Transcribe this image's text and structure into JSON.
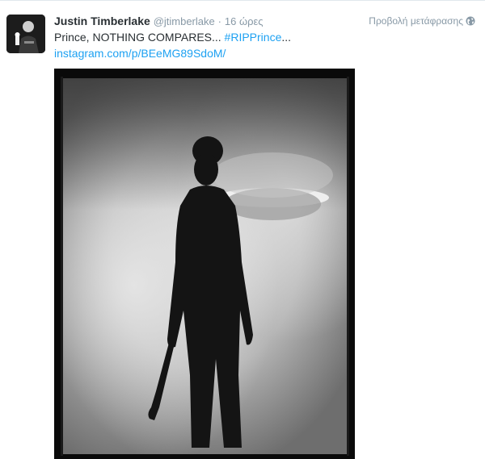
{
  "tweet": {
    "author_name": "Justin Timberlake",
    "username": "@jtimberlake",
    "separator": "·",
    "timestamp": "16 ώρες",
    "translate_label": "Προβολή μετάφρασης",
    "translate_icon": "globe-icon",
    "text_prefix": "Prince, NOTHING COMPARES... ",
    "hashtag": "#RIPPrince",
    "text_suffix": "...",
    "link": "instagram.com/p/BEeMG89SdoM/",
    "link_color": "#1da1f2",
    "name_color": "#292f33",
    "meta_color": "#8899a6"
  }
}
